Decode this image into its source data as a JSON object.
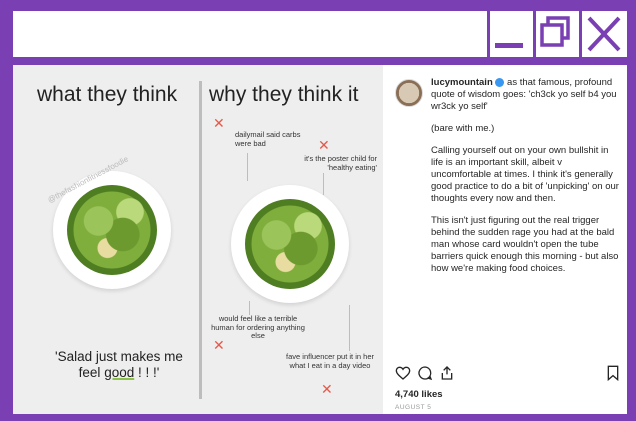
{
  "window": {
    "title": "",
    "min_label": "minimize",
    "max_label": "restore",
    "close_label": "close"
  },
  "infographic": {
    "left_title": "what they think",
    "right_title": "why they think it",
    "quote_pre": "'Salad just makes me feel ",
    "quote_em": "good",
    "quote_post": " ! ! !'",
    "handle": "@thefashionfitnessfoodie",
    "annotations": [
      "dailymail said carbs were bad",
      "it's the poster child for 'healthy eating'",
      "would feel like a terrible human for ordering anything else",
      "fave influencer put it in her what I eat in a day video"
    ]
  },
  "post": {
    "username": "lucymountain",
    "caption_lead": " as that famous, profound quote of wisdom goes: 'ch3ck yo self b4 you wr3ck yo self'",
    "para2": "(bare with me.)",
    "para3": "Calling yourself out on your own bullshit in life is an important skill, albeit v uncomfortable at times. I think it's generally good practice to do a bit of 'unpicking' on our thoughts every now and then.",
    "para4": "This isn't just figuring out the real trigger behind the sudden rage you had at the bald man whose card wouldn't open the tube barriers quick enough this morning - but also how we're making food choices.",
    "likes": "4,740 likes",
    "date": "AUGUST 5"
  },
  "colors": {
    "frame": "#7a3fb3",
    "accent_cross": "#e25b4c",
    "verified": "#3897f0"
  },
  "icons": [
    "minimize-icon",
    "restore-icon",
    "close-icon",
    "heart-icon",
    "comment-icon",
    "share-icon",
    "bookmark-icon",
    "verified-icon"
  ]
}
